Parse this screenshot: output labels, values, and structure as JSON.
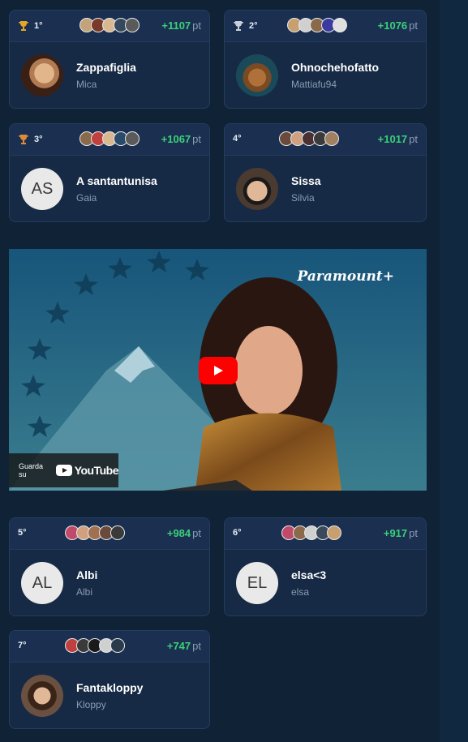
{
  "units_label": "pt",
  "cards": [
    {
      "rank": "1°",
      "trophy": true,
      "points": "+1107",
      "name": "Zappafiglia",
      "username": "Mica",
      "avatar_type": "photo",
      "avatar_colors": [
        "#c4a27a",
        "#7a3a2a",
        "#d8b890",
        "#34495e",
        "#5a5a5a"
      ]
    },
    {
      "rank": "2°",
      "trophy": true,
      "points": "+1076",
      "name": "Ohnochehofatto",
      "username": "Mattiafu94",
      "avatar_type": "photo",
      "avatar_colors": [
        "#c8a070",
        "#d0d0d0",
        "#8a6a4a",
        "#3a3aa0",
        "#e0e0e0"
      ]
    },
    {
      "rank": "3°",
      "trophy": true,
      "points": "+1067",
      "name": "A santantunisa",
      "username": "Gaia",
      "avatar_type": "initials",
      "initials": "AS",
      "avatar_colors": [
        "#8a6a4a",
        "#c04040",
        "#d8b890",
        "#2a4a6a",
        "#5a5a5a"
      ]
    },
    {
      "rank": "4°",
      "trophy": false,
      "points": "+1017",
      "name": "Sissa",
      "username": "Silvia",
      "avatar_type": "photo",
      "avatar_colors": [
        "#6a4a3a",
        "#d0a080",
        "#4a3030",
        "#3a3a3a",
        "#a08060"
      ]
    },
    {
      "rank": "5°",
      "trophy": false,
      "points": "+984",
      "name": "Albi",
      "username": "Albi",
      "avatar_type": "initials",
      "initials": "AL",
      "avatar_colors": [
        "#c04a6a",
        "#d0a080",
        "#a07050",
        "#6a4a3a",
        "#3a3a3a"
      ]
    },
    {
      "rank": "6°",
      "trophy": false,
      "points": "+917",
      "name": "elsa<3",
      "username": "elsa",
      "avatar_type": "initials",
      "initials": "EL",
      "avatar_colors": [
        "#c04a6a",
        "#8a6a4a",
        "#d0d0d0",
        "#3a4a5a",
        "#c8a070"
      ]
    },
    {
      "rank": "7°",
      "trophy": false,
      "points": "+747",
      "name": "Fantakloppy",
      "username": "Kloppy",
      "avatar_type": "photo",
      "avatar_colors": [
        "#c04040",
        "#3a3a3a",
        "#1a1a1a",
        "#d0d0d0",
        "#2a3a4a"
      ]
    }
  ],
  "video": {
    "brand": "Paramount+",
    "watch_on": "Guarda su",
    "youtube_label": "YouTube"
  },
  "colors": {
    "points_green": "#3ad07a",
    "trophy_gold": "#e6a526",
    "trophy_silver": "#c8d0da",
    "trophy_bronze": "#e08a3a",
    "card_bg": "#172a45"
  }
}
